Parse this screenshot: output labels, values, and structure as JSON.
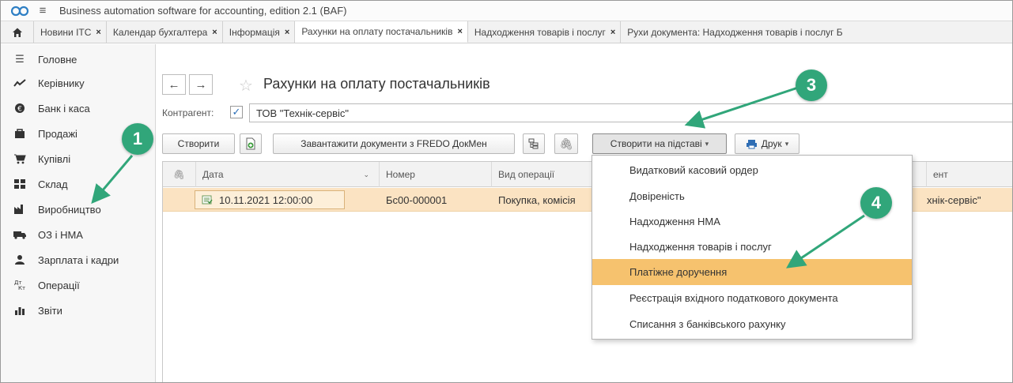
{
  "window": {
    "app_title": "Business automation software for accounting, edition 2.1  (BAF)",
    "logo_icon": "1c-logo-icon",
    "menu_icon": "hamburger-icon"
  },
  "tabs": [
    {
      "label": "Новини ITC",
      "active": false
    },
    {
      "label": "Календар бухгалтера",
      "active": false
    },
    {
      "label": "Інформація",
      "active": false
    },
    {
      "label": "Рахунки на оплату постачальників",
      "active": true
    },
    {
      "label": "Надходження товарів і послуг",
      "active": false
    },
    {
      "label": "Рухи документа: Надходження товарів і послуг Б",
      "active": false
    }
  ],
  "tab_close_symbol": "×",
  "sidebar": {
    "items": [
      {
        "label": "Головне",
        "icon": "list-icon"
      },
      {
        "label": "Керівнику",
        "icon": "trend-icon"
      },
      {
        "label": "Банк і каса",
        "icon": "coin-icon"
      },
      {
        "label": "Продажі",
        "icon": "bag-icon"
      },
      {
        "label": "Купівлі",
        "icon": "cart-icon"
      },
      {
        "label": "Склад",
        "icon": "warehouse-icon"
      },
      {
        "label": "Виробництво",
        "icon": "factory-icon"
      },
      {
        "label": "ОЗ і НМА",
        "icon": "truck-icon"
      },
      {
        "label": "Зарплата і кадри",
        "icon": "person-icon"
      },
      {
        "label": "Операції",
        "icon": "debit-credit-icon"
      },
      {
        "label": "Звіти",
        "icon": "bar-chart-icon"
      }
    ]
  },
  "page": {
    "title": "Рахунки на оплату постачальників",
    "filter_label": "Контрагент:",
    "filter_checked": true,
    "filter_value": "ТОВ \"Технік-сервіс\""
  },
  "toolbar": {
    "create_label": "Створити",
    "upload_label": "Завантажити документи з FREDO ДокМен",
    "create_based_label": "Створити на підставі",
    "print_label": "Друк"
  },
  "table": {
    "columns": [
      "Дата",
      "Номер",
      "Вид операції",
      "ент"
    ],
    "rows": [
      {
        "date": "10.11.2021 12:00:00",
        "number": "Бс00-000001",
        "operation": "Покупка, комісія",
        "counterparty": "хнік-сервіс\""
      }
    ]
  },
  "dropdown": {
    "items": [
      {
        "label": "Видатковий касовий ордер",
        "highlighted": false
      },
      {
        "label": "Довіреність",
        "highlighted": false
      },
      {
        "label": "Надходження НМА",
        "highlighted": false
      },
      {
        "label": "Надходження товарів і послуг",
        "highlighted": false
      },
      {
        "label": "Платіжне доручення",
        "highlighted": true
      },
      {
        "label": "Реєстрація вхідного податкового документа",
        "highlighted": false
      },
      {
        "label": "Списання з банківського рахунку",
        "highlighted": false
      }
    ]
  },
  "annotations": {
    "badges": [
      "1",
      "3",
      "4"
    ],
    "color": "#31a67a"
  },
  "colors": {
    "row_highlight": "#fbe3c2",
    "menu_highlight": "#f6c26e",
    "checkbox": "#2c6fb8"
  }
}
